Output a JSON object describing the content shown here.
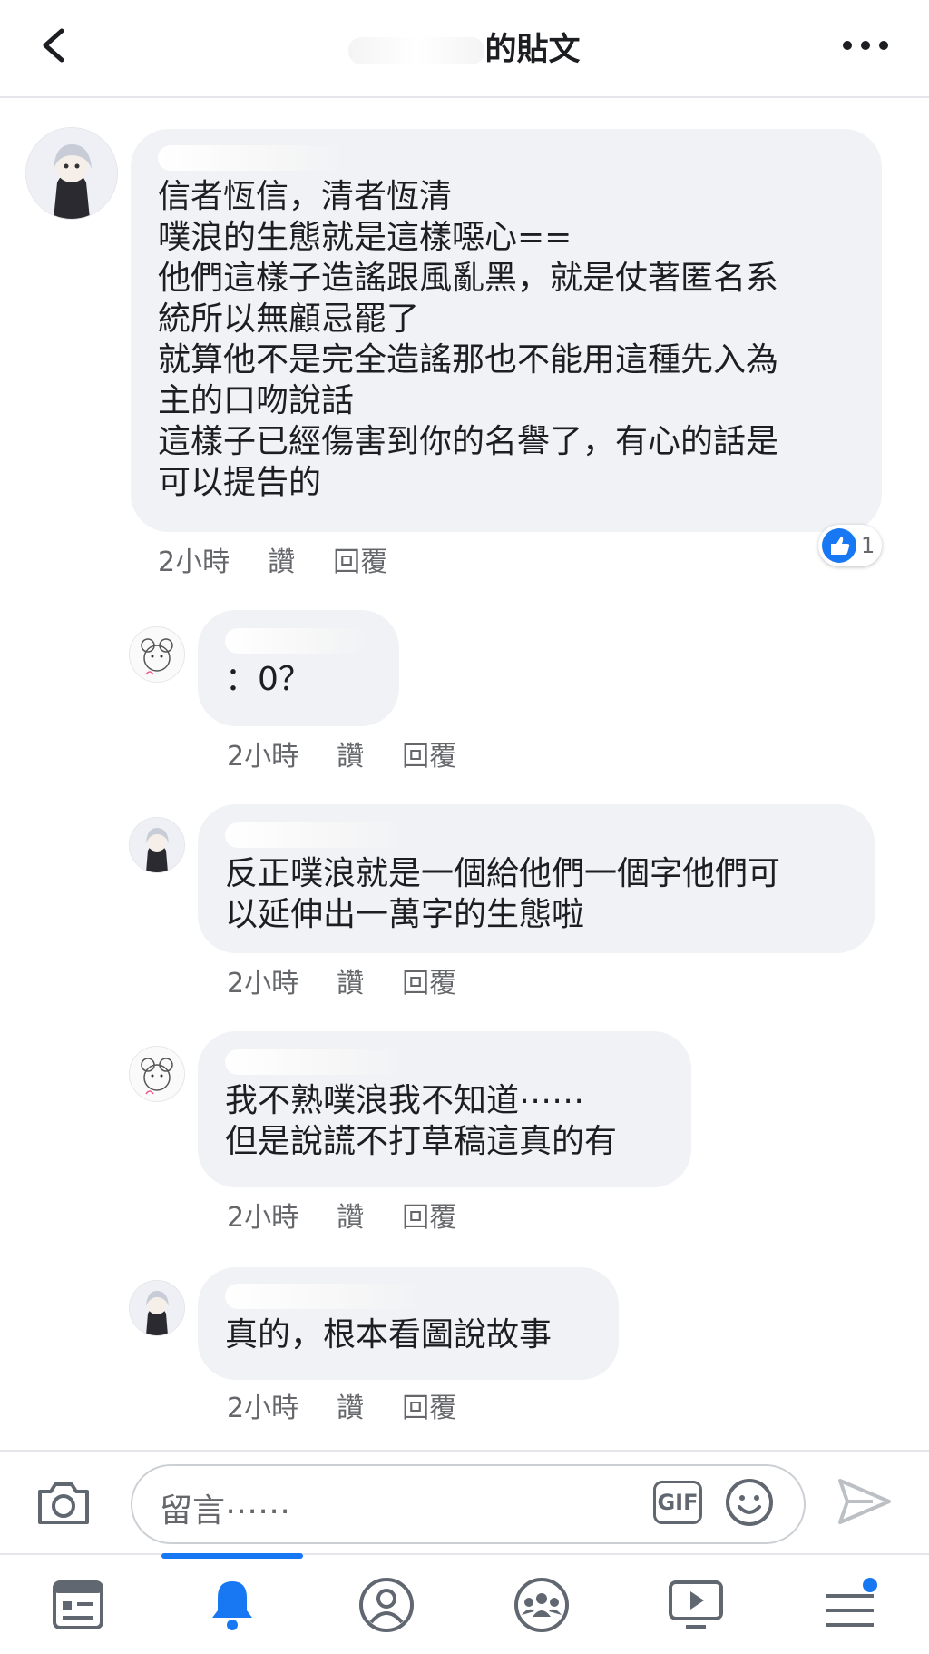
{
  "header": {
    "title_suffix": "的貼文"
  },
  "comments": [
    {
      "lines": [
        "信者恆信，清者恆清",
        "噗浪的生態就是這樣噁心==",
        "他們這樣子造謠跟風亂黑，就是仗著匿名系",
        "統所以無顧忌罷了",
        "就算他不是完全造謠那也不能用這種先入為",
        "主的口吻說話",
        "這樣子已經傷害到你的名譽了，有心的話是",
        "可以提告的"
      ],
      "time": "2小時",
      "like": "讚",
      "reply": "回覆",
      "reaction_count": "1"
    },
    {
      "lines": [
        "：0？"
      ],
      "time": "2小時",
      "like": "讚",
      "reply": "回覆"
    },
    {
      "lines": [
        "反正噗浪就是一個給他們一個字他們可",
        "以延伸出一萬字的生態啦"
      ],
      "time": "2小時",
      "like": "讚",
      "reply": "回覆"
    },
    {
      "lines": [
        "我不熟噗浪我不知道⋯⋯",
        "但是說謊不打草稿這真的有"
      ],
      "time": "2小時",
      "like": "讚",
      "reply": "回覆"
    },
    {
      "lines": [
        "真的，根本看圖說故事"
      ],
      "time": "2小時",
      "like": "讚",
      "reply": "回覆"
    }
  ],
  "composer": {
    "placeholder": "留言⋯⋯",
    "gif_label": "GIF"
  },
  "colors": {
    "accent": "#1877f2",
    "bubble": "#f0f2f5",
    "meta_text": "#65676b"
  },
  "icons": [
    "back-arrow-icon",
    "more-dots-icon",
    "camera-icon",
    "gif-icon",
    "emoji-icon",
    "send-icon",
    "news-feed-icon",
    "notifications-bell-icon",
    "profile-icon",
    "groups-icon",
    "watch-video-icon",
    "menu-icon"
  ]
}
